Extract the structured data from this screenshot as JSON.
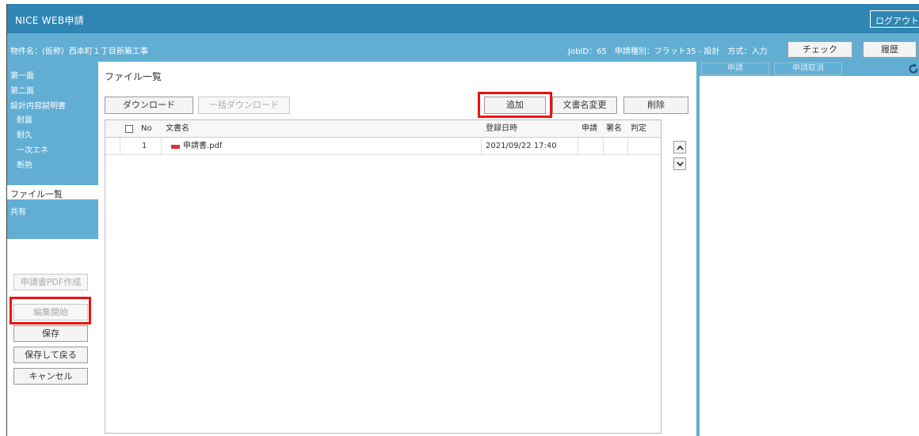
{
  "app": {
    "title": "NICE WEB申請",
    "logout_label": "ログアウト"
  },
  "infobar": {
    "property_name": "物件名：(仮称）西本町１丁目新築工事",
    "job_info": "JobID：65　申請種別：フラット35 - 設計　方式：入力",
    "check_label": "チェック",
    "history_label": "履歴"
  },
  "sidebar": {
    "items": [
      {
        "label": "第一面"
      },
      {
        "label": "第二面"
      },
      {
        "label": "設計内容説明書"
      },
      {
        "label": "耐震"
      },
      {
        "label": "耐久"
      },
      {
        "label": "一次エネ"
      },
      {
        "label": "断熱"
      },
      {
        "label": "ファイル一覧"
      },
      {
        "label": "共有"
      }
    ],
    "buttons": {
      "pdf_create": "申請書PDF作成",
      "edit_start": "編集開始",
      "save": "保存",
      "save_return": "保存して戻る",
      "cancel": "キャンセル"
    }
  },
  "main": {
    "title": "ファイル一覧",
    "toolbar": {
      "download": "ダウンロード",
      "bulk_download": "一括ダウンロード",
      "add": "追加",
      "rename": "文書名変更",
      "delete": "削除"
    },
    "table": {
      "columns": {
        "no": "No",
        "doc_name": "文書名",
        "registered": "登録日時",
        "apply": "申請",
        "sign": "署名",
        "judge": "判定"
      },
      "rows": [
        {
          "no": "1",
          "doc_name": "申請書.pdf",
          "registered": "2021/09/22 17:40",
          "apply": "",
          "sign": "",
          "judge": ""
        }
      ]
    }
  },
  "right_panel": {
    "apply_label": "申請",
    "cancel_apply_label": "申請取消"
  },
  "colors": {
    "header": "#2f86b2",
    "subheader": "#62aed3",
    "highlight": "#ee1111",
    "pdf_icon": "#e3312d"
  },
  "icons": {
    "pdf": "pdf-file-icon",
    "up": "chevron-up-icon",
    "down": "chevron-down-icon",
    "refresh": "refresh-icon"
  }
}
